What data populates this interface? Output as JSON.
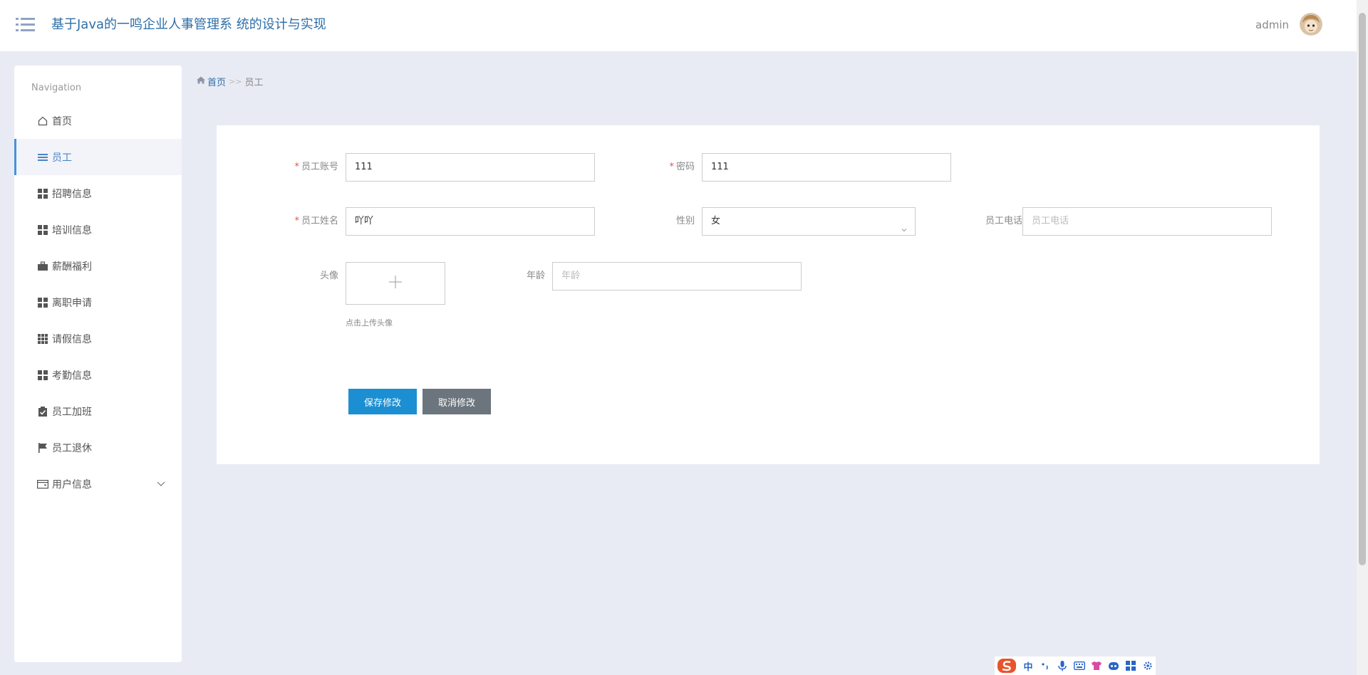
{
  "header": {
    "app_title": "基于Java的一鸣企业人事管理系 统的设计与实现",
    "username": "admin"
  },
  "sidebar": {
    "caption": "Navigation",
    "items": [
      {
        "label": "首页",
        "icon": "home-icon"
      },
      {
        "label": "员工",
        "icon": "list-icon",
        "active": true
      },
      {
        "label": "招聘信息",
        "icon": "grid-icon"
      },
      {
        "label": "培训信息",
        "icon": "grid-icon"
      },
      {
        "label": "薪酬福利",
        "icon": "briefcase-icon"
      },
      {
        "label": "离职申请",
        "icon": "grid-icon"
      },
      {
        "label": "请假信息",
        "icon": "grid-9-icon"
      },
      {
        "label": "考勤信息",
        "icon": "grid-icon"
      },
      {
        "label": "员工加班",
        "icon": "clipboard-check-icon"
      },
      {
        "label": "员工退休",
        "icon": "flag-icon"
      },
      {
        "label": "用户信息",
        "icon": "wallet-icon",
        "has_submenu": true
      }
    ]
  },
  "breadcrumb": {
    "home": "首页",
    "separator": ">>",
    "current": "员工"
  },
  "form": {
    "account": {
      "label": "员工账号",
      "value": "111",
      "required": true
    },
    "password": {
      "label": "密码",
      "value": "111",
      "required": true
    },
    "name": {
      "label": "员工姓名",
      "value": "吖吖",
      "required": true
    },
    "gender": {
      "label": "性别",
      "value": "女"
    },
    "phone": {
      "label": "员工电话",
      "placeholder": "员工电话"
    },
    "avatar": {
      "label": "头像",
      "hint": "点击上传头像"
    },
    "age": {
      "label": "年龄",
      "placeholder": "年龄"
    },
    "save_label": "保存修改",
    "cancel_label": "取消修改"
  },
  "ime_toolbar": {
    "mode_label": "中"
  },
  "colors": {
    "accent": "#1b8fd2",
    "title": "#2d6ea8",
    "required": "#e4534f",
    "cancel": "#6c757d",
    "background": "#e9ebf4"
  }
}
